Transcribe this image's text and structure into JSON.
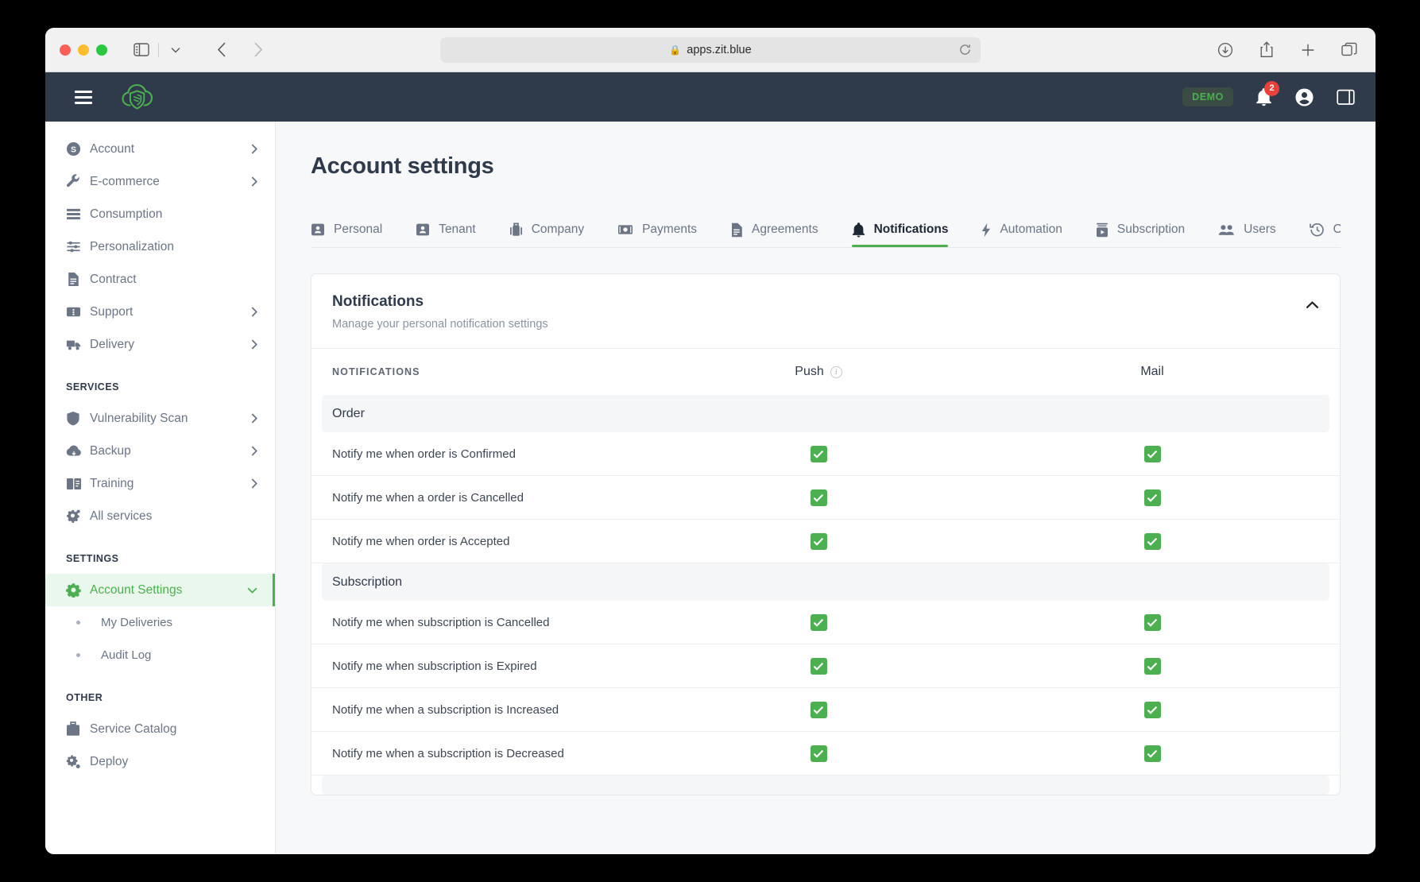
{
  "browser": {
    "url": "apps.zit.blue",
    "lock_icon": "lock-icon",
    "sidebar_toggle_icon": "sidebar-toggle-icon",
    "back_icon": "back-arrow-icon",
    "forward_icon": "forward-arrow-icon",
    "shield_icon": "privacy-shield-icon",
    "reload_icon": "reload-icon",
    "download_icon": "download-icon",
    "share_icon": "share-icon",
    "new_tab_icon": "plus-icon",
    "tab_overview_icon": "tab-overview-icon"
  },
  "app_header": {
    "menu_icon": "hamburger-menu-icon",
    "logo_icon": "cloud-shield-logo",
    "demo_badge": "DEMO",
    "bell_icon": "bell-icon",
    "notification_count": "2",
    "account_icon": "account-circle-icon",
    "panel_icon": "right-panel-icon"
  },
  "sidebar": {
    "items": [
      {
        "label": "Account",
        "icon": "dollar-circle-icon",
        "chevron": true
      },
      {
        "label": "E-commerce",
        "icon": "wrench-icon",
        "chevron": true
      },
      {
        "label": "Consumption",
        "icon": "list-icon",
        "chevron": false
      },
      {
        "label": "Personalization",
        "icon": "sliders-icon",
        "chevron": false
      },
      {
        "label": "Contract",
        "icon": "document-icon",
        "chevron": false
      },
      {
        "label": "Support",
        "icon": "ticket-icon",
        "chevron": true
      },
      {
        "label": "Delivery",
        "icon": "truck-icon",
        "chevron": true
      }
    ],
    "services_title": "SERVICES",
    "services": [
      {
        "label": "Vulnerability Scan",
        "icon": "shield-icon",
        "chevron": true
      },
      {
        "label": "Backup",
        "icon": "cloud-icon",
        "chevron": true
      },
      {
        "label": "Training",
        "icon": "book-icon",
        "chevron": true
      },
      {
        "label": "All services",
        "icon": "gear-plus-icon",
        "chevron": false
      }
    ],
    "settings_title": "SETTINGS",
    "settings": [
      {
        "label": "Account Settings",
        "icon": "gear-icon",
        "chevron": true,
        "active": true
      }
    ],
    "sub_items": [
      {
        "label": "My Deliveries"
      },
      {
        "label": "Audit Log"
      }
    ],
    "other_title": "OTHER",
    "other": [
      {
        "label": "Service Catalog",
        "icon": "briefcase-icon",
        "chevron": false
      },
      {
        "label": "Deploy",
        "icon": "gears-icon",
        "chevron": false
      }
    ]
  },
  "main": {
    "page_title": "Account settings",
    "tabs": [
      {
        "label": "Personal",
        "icon": "contact-card-icon",
        "active": false
      },
      {
        "label": "Tenant",
        "icon": "contact-card-icon",
        "active": false
      },
      {
        "label": "Company",
        "icon": "briefcase-icon",
        "active": false
      },
      {
        "label": "Payments",
        "icon": "banknote-icon",
        "active": false
      },
      {
        "label": "Agreements",
        "icon": "document-icon",
        "active": false
      },
      {
        "label": "Notifications",
        "icon": "bell-icon",
        "active": true
      },
      {
        "label": "Automation",
        "icon": "bolt-icon",
        "active": false
      },
      {
        "label": "Subscription",
        "icon": "server-icon",
        "active": false
      },
      {
        "label": "Users",
        "icon": "users-icon",
        "active": false
      },
      {
        "label": "Order hi",
        "icon": "history-icon",
        "active": false
      }
    ]
  },
  "card": {
    "title": "Notifications",
    "subtitle": "Manage your personal notification settings",
    "collapse_icon": "chevron-up-icon",
    "table": {
      "col_name": "NOTIFICATIONS",
      "col_push": "Push",
      "col_push_info_icon": "info-icon",
      "col_mail": "Mail",
      "groups": [
        {
          "name": "Order",
          "rows": [
            {
              "label": "Notify me when order is Confirmed",
              "push": true,
              "mail": true
            },
            {
              "label": "Notify me when a order is Cancelled",
              "push": true,
              "mail": true
            },
            {
              "label": "Notify me when order is Accepted",
              "push": true,
              "mail": true
            }
          ]
        },
        {
          "name": "Subscription",
          "rows": [
            {
              "label": "Notify me when subscription is Cancelled",
              "push": true,
              "mail": true
            },
            {
              "label": "Notify me when subscription is Expired",
              "push": true,
              "mail": true
            },
            {
              "label": "Notify me when a subscription is Increased",
              "push": true,
              "mail": true
            },
            {
              "label": "Notify me when a subscription is Decreased",
              "push": true,
              "mail": true
            }
          ]
        }
      ]
    }
  },
  "colors": {
    "accent_green": "#4caf50",
    "header_dark": "#2f3a4a",
    "badge_red": "#e8413b",
    "page_bg": "#f7f8fa"
  }
}
